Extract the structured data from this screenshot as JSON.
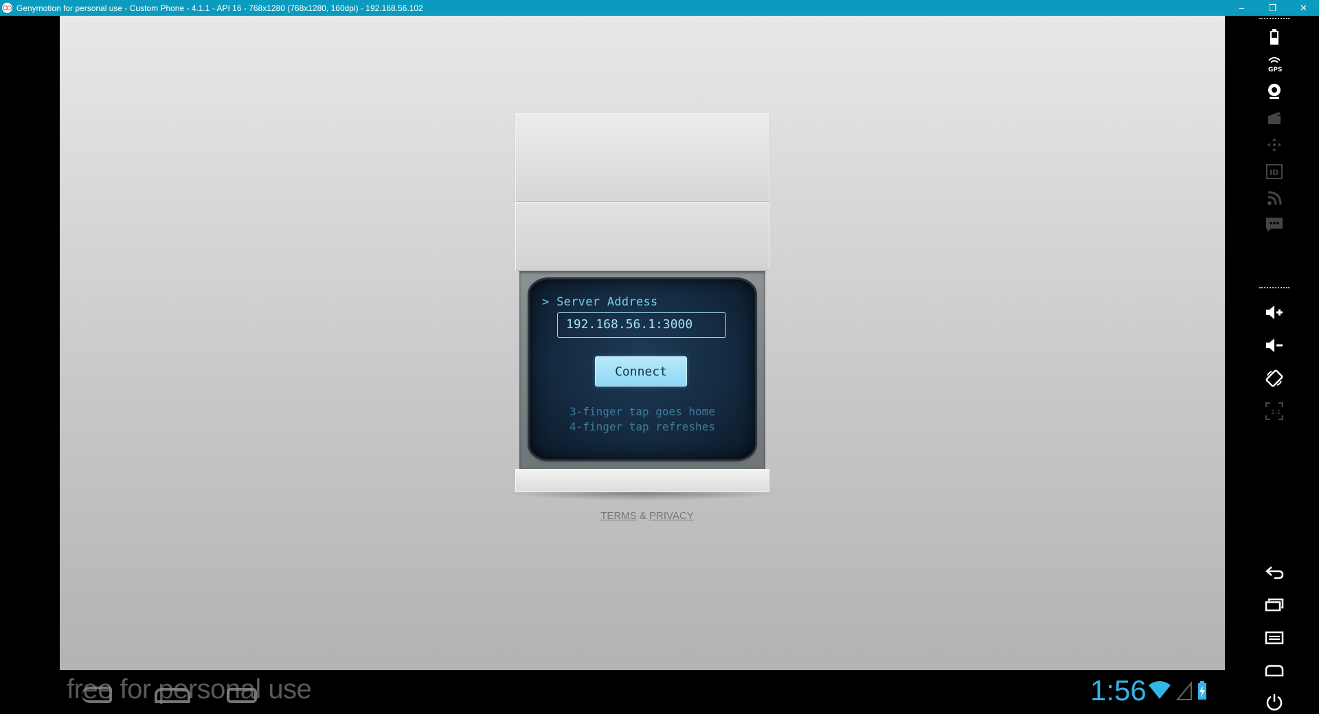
{
  "window": {
    "title": "Genymotion for personal use - Custom Phone - 4.1.1 - API 16 - 768x1280 (768x1280, 160dpi) - 192.168.56.102",
    "controls": {
      "minimize": "–",
      "restore": "❐",
      "close": "✕"
    }
  },
  "app": {
    "prompt": "> Server Address",
    "server_address": "192.168.56.1:3000",
    "connect_label": "Connect",
    "hint_1": "3-finger tap goes home",
    "hint_2": "4-finger tap refreshes",
    "terms": "TERMS",
    "amp": "&",
    "privacy": "PRIVACY"
  },
  "android": {
    "watermark": "free for personal use",
    "clock": "1:56"
  },
  "sidebar": {
    "top_icons": [
      "battery-icon",
      "gps-icon",
      "webcam-icon",
      "capture-icon",
      "dpad-icon",
      "device-id-icon",
      "network-icon",
      "sms-icon"
    ],
    "mid_icons": [
      "volume-up-icon",
      "volume-down-icon",
      "rotate-icon",
      "scale-icon"
    ],
    "bottom_icons": [
      "back-icon",
      "recent-apps-icon",
      "menu-icon",
      "home-icon",
      "power-icon"
    ]
  },
  "colors": {
    "titlebar": "#0a9bbf",
    "crt_text": "#78cdeb",
    "button": "#8fd8f3",
    "clock": "#33b5e5"
  }
}
